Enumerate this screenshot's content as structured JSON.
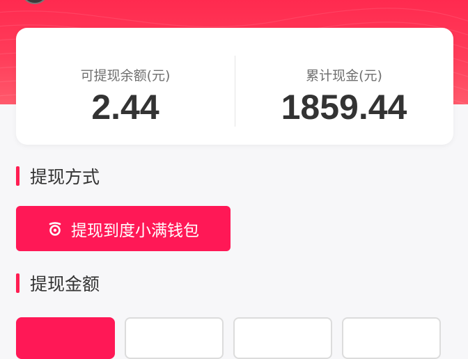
{
  "colors": {
    "brand": "#ff1856",
    "header": "#ff2a4f",
    "text": "#333333",
    "muted": "#6f6f6f"
  },
  "balance": {
    "withdrawable_label": "可提现余额(元)",
    "withdrawable_value": "2.44",
    "total_label": "累计现金(元)",
    "total_value": "1859.44"
  },
  "withdraw_method": {
    "title": "提现方式",
    "option_label": "提现到度小满钱包",
    "option_icon": "du-xiaoman-wallet-icon"
  },
  "withdraw_amount": {
    "title": "提现金额",
    "options": [
      {
        "label": "",
        "selected": true
      },
      {
        "label": "",
        "selected": false
      },
      {
        "label": "",
        "selected": false
      },
      {
        "label": "",
        "selected": false
      }
    ]
  }
}
